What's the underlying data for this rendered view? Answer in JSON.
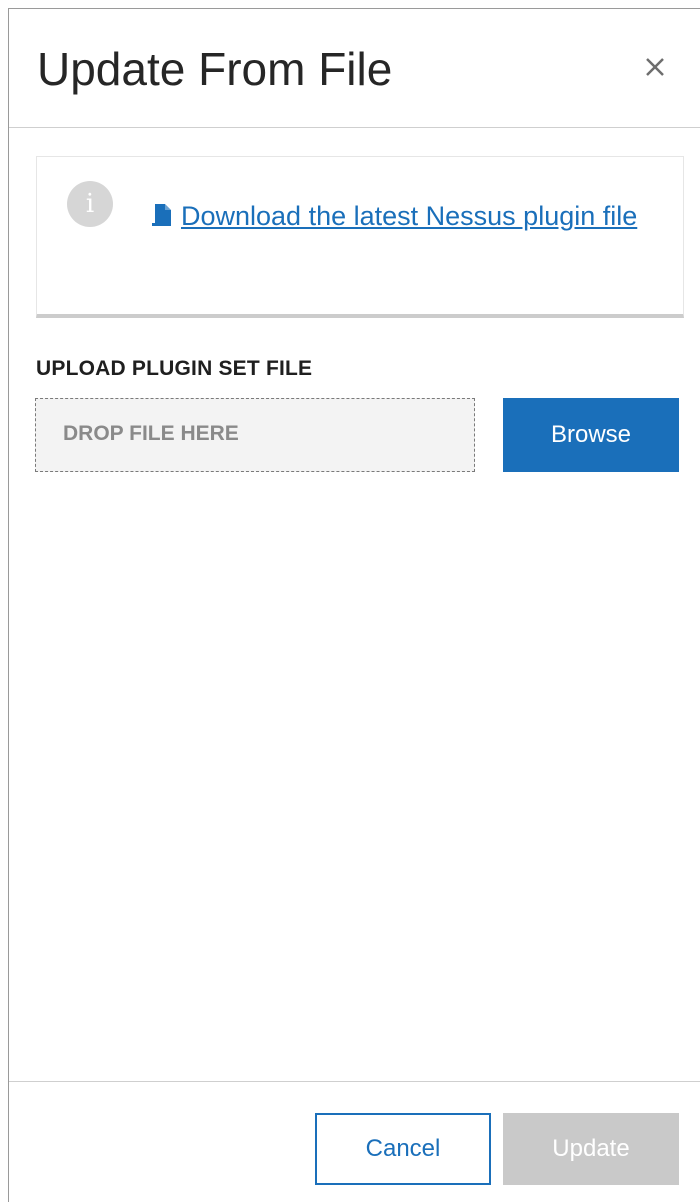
{
  "dialog": {
    "title": "Update From File",
    "close_label": "×"
  },
  "info": {
    "icon_text": "i",
    "download_link_text": "Download the latest Nessus plugin file"
  },
  "upload": {
    "label": "UPLOAD PLUGIN SET FILE",
    "drop_zone_text": "DROP FILE HERE",
    "browse_label": "Browse"
  },
  "footer": {
    "cancel_label": "Cancel",
    "update_label": "Update"
  },
  "colors": {
    "accent": "#1a6fba",
    "disabled": "#c9c9c9",
    "title_text": "#262626"
  },
  "icons": {
    "close": "close-icon",
    "info": "info-icon",
    "file": "file-icon"
  }
}
